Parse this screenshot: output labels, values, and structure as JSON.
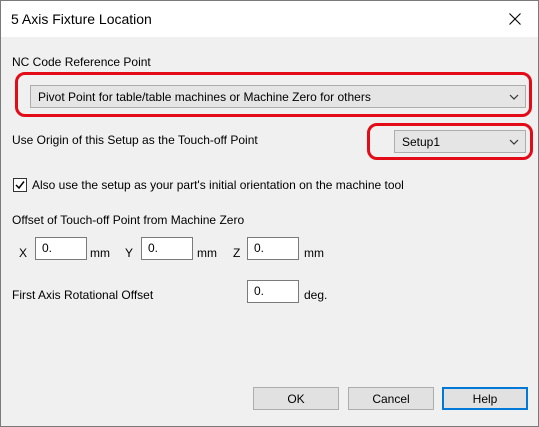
{
  "window": {
    "title": "5 Axis Fixture Location"
  },
  "nc_reference": {
    "label": "NC Code Reference Point",
    "selected": "Pivot Point for table/table machines or Machine Zero for others"
  },
  "origin": {
    "label": "Use Origin of this Setup as the Touch-off Point",
    "selected": "Setup1"
  },
  "orientation": {
    "checked": true,
    "label": "Also use the setup as your part's initial orientation on the machine tool"
  },
  "offset": {
    "label": "Offset of Touch-off Point from Machine Zero",
    "x_label": "X",
    "x_value": "0.",
    "x_unit": "mm",
    "y_label": "Y",
    "y_value": "0.",
    "y_unit": "mm",
    "z_label": "Z",
    "z_value": "0.",
    "z_unit": "mm"
  },
  "rotational": {
    "label": "First Axis Rotational Offset",
    "value": "0.",
    "unit": "deg."
  },
  "buttons": {
    "ok": "OK",
    "cancel": "Cancel",
    "help": "Help"
  },
  "colors": {
    "highlight": "#e30b17",
    "default_button_border": "#0078d7"
  },
  "icons": {
    "close": "close-icon",
    "dropdown": "chevron-down-icon",
    "check": "checkmark-icon"
  }
}
